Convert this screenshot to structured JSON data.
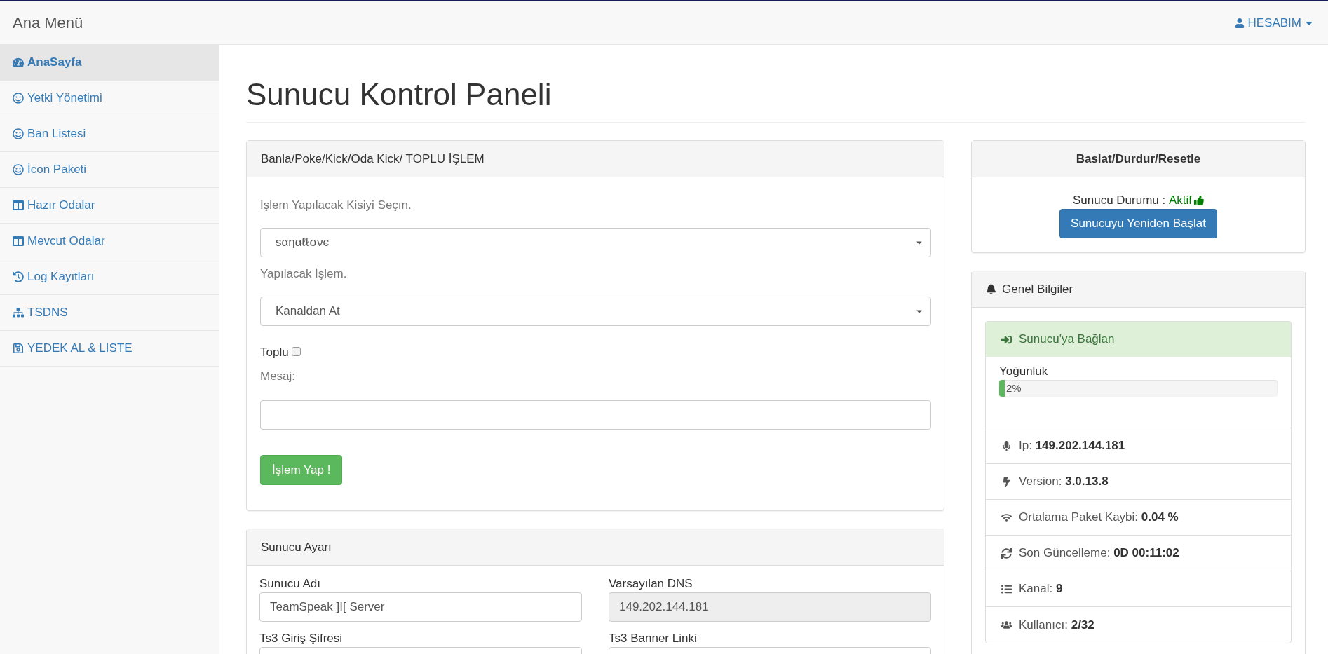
{
  "navbar": {
    "brand": "Ana Menü",
    "account": "HESABIM"
  },
  "sidebar": {
    "items": [
      {
        "label": "AnaSayfa",
        "selected": true
      },
      {
        "label": "Yetki Yönetimi",
        "selected": false
      },
      {
        "label": "Ban Listesi",
        "selected": false
      },
      {
        "label": "İcon Paketi",
        "selected": false
      },
      {
        "label": "Hazır Odalar",
        "selected": false
      },
      {
        "label": "Mevcut Odalar",
        "selected": false
      },
      {
        "label": "Log Kayıtları",
        "selected": false
      },
      {
        "label": "TSDNS",
        "selected": false
      },
      {
        "label": "YEDEK AL & LISTE",
        "selected": false
      }
    ]
  },
  "page_title": "Sunucu Kontrol Paneli",
  "action_panel": {
    "title": "Banla/Poke/Kick/Oda Kick/ TOPLU İŞLEM",
    "target_label": "Işlem Yapılacak Kisiyi Seçın.",
    "target_value": "sαηαℓℓσνє",
    "action_label": "Yapılacak İşlem.",
    "action_value": "Kanaldan At",
    "bulk": {
      "label": "Toplu",
      "checked": false
    },
    "message_label": "Mesaj:",
    "submit": "İşlem Yap !"
  },
  "settings_panel": {
    "title": "Sunucu Ayarı",
    "fields": [
      {
        "label": "Sunucu Adı",
        "value": "TeamSpeak ]I[ Server",
        "disabled": false
      },
      {
        "label": "Varsayılan DNS",
        "value": "149.202.144.181",
        "disabled": true
      },
      {
        "label": "Ts3 Giriş Şifresi",
        "disabled": false
      },
      {
        "label": "Ts3 Banner Linki",
        "disabled": false
      }
    ]
  },
  "control_panel": {
    "title": "Baslat/Durdur/Resetle",
    "status_label": "Sunucu Durumu :",
    "status_value": "Aktif",
    "restart": "Sunucuyu Yeniden Başlat"
  },
  "info_panel": {
    "title": "Genel Bilgiler",
    "connect": "Sunucu'ya Bağlan",
    "load": {
      "label": "Yoğunluk",
      "level": 0.02,
      "reading": "2%"
    },
    "rows": [
      {
        "label": "Ip:",
        "value": "149.202.144.181"
      },
      {
        "label": "Version:",
        "value": "3.0.13.8"
      },
      {
        "label": "Ortalama Paket Kaybi:",
        "value": "0.04 %"
      },
      {
        "label": "Son Güncelleme:",
        "value": "0D 00:11:02"
      },
      {
        "label": "Kanal:",
        "value": "9"
      },
      {
        "label": "Kullanıcı:",
        "value": "2/32"
      }
    ]
  }
}
